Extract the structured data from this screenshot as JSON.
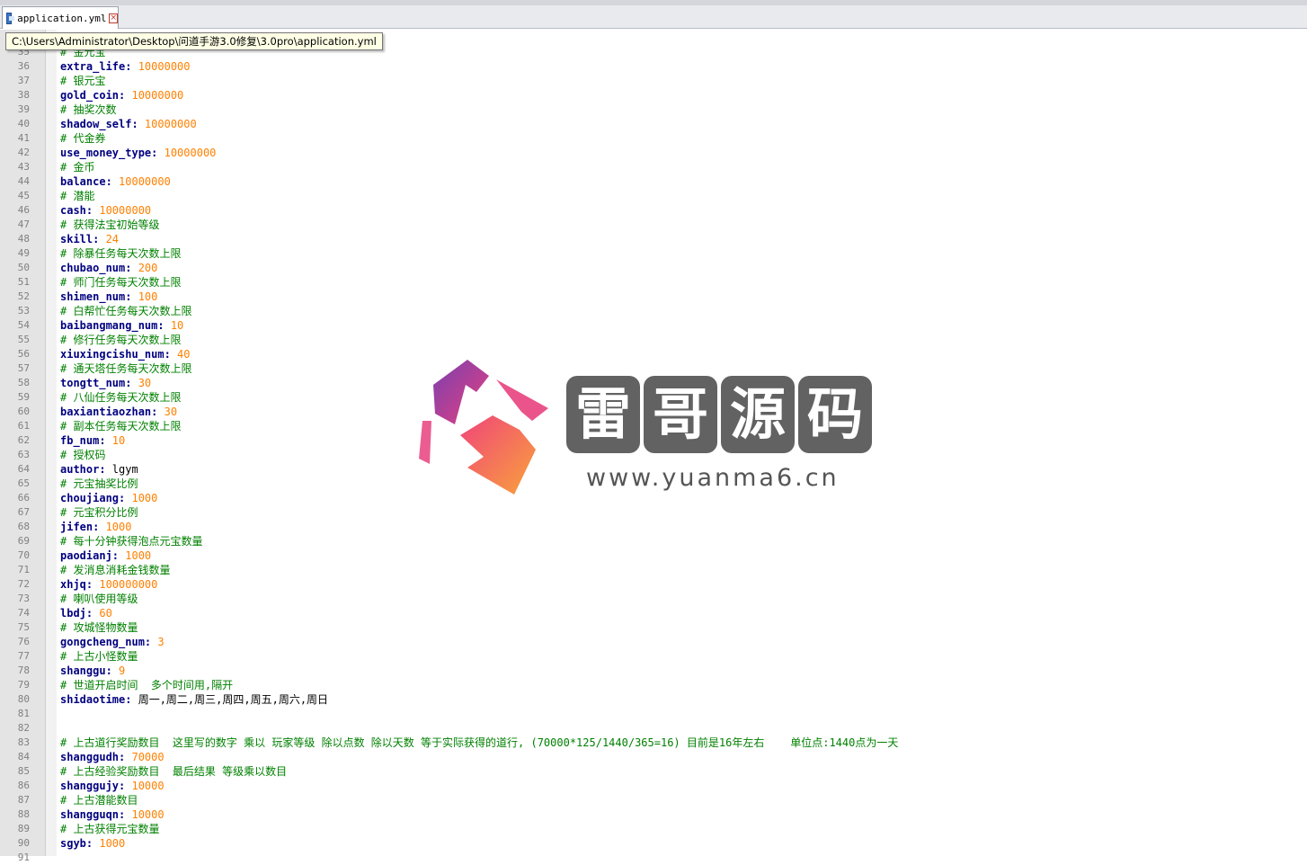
{
  "tab": {
    "filename": "application.yml",
    "close": "×"
  },
  "tooltip": {
    "path": "C:\\Users\\Administrator\\Desktop\\问道手游3.0修复\\3.0pro\\application.yml"
  },
  "editor": {
    "colors": {
      "key": "#000080",
      "number": "#ff8000",
      "comment": "#008000"
    },
    "lines": [
      {
        "n": "35",
        "k": "cmt",
        "c": "# 金元宝"
      },
      {
        "n": "36",
        "k": "kv",
        "key": "extra_life:",
        "v": "10000000",
        "t": "num"
      },
      {
        "n": "37",
        "k": "cmt",
        "c": "# 银元宝"
      },
      {
        "n": "38",
        "k": "kv",
        "key": "gold_coin:",
        "v": "10000000",
        "t": "num"
      },
      {
        "n": "39",
        "k": "cmt",
        "c": "# 抽奖次数"
      },
      {
        "n": "40",
        "k": "kv",
        "key": "shadow_self:",
        "v": "10000000",
        "t": "num"
      },
      {
        "n": "41",
        "k": "cmt",
        "c": "# 代金券"
      },
      {
        "n": "42",
        "k": "kv",
        "key": "use_money_type:",
        "v": "10000000",
        "t": "num"
      },
      {
        "n": "43",
        "k": "cmt",
        "c": "# 金币"
      },
      {
        "n": "44",
        "k": "kv",
        "key": "balance:",
        "v": "10000000",
        "t": "num"
      },
      {
        "n": "45",
        "k": "cmt",
        "c": "# 潜能"
      },
      {
        "n": "46",
        "k": "kv",
        "key": "cash:",
        "v": "10000000",
        "t": "num"
      },
      {
        "n": "47",
        "k": "cmt",
        "c": "# 获得法宝初始等级"
      },
      {
        "n": "48",
        "k": "kv",
        "key": "skill:",
        "v": "24",
        "t": "num"
      },
      {
        "n": "49",
        "k": "cmt",
        "c": "# 除暴任务每天次数上限"
      },
      {
        "n": "50",
        "k": "kv",
        "key": "chubao_num:",
        "v": "200",
        "t": "num"
      },
      {
        "n": "51",
        "k": "cmt",
        "c": "# 师门任务每天次数上限"
      },
      {
        "n": "52",
        "k": "kv",
        "key": "shimen_num:",
        "v": "100",
        "t": "num"
      },
      {
        "n": "53",
        "k": "cmt",
        "c": "# 白帮忙任务每天次数上限"
      },
      {
        "n": "54",
        "k": "kv",
        "key": "baibangmang_num:",
        "v": "10",
        "t": "num"
      },
      {
        "n": "55",
        "k": "cmt",
        "c": "# 修行任务每天次数上限"
      },
      {
        "n": "56",
        "k": "kv",
        "key": "xiuxingcishu_num:",
        "v": "40",
        "t": "num"
      },
      {
        "n": "57",
        "k": "cmt",
        "c": "# 通天塔任务每天次数上限"
      },
      {
        "n": "58",
        "k": "kv",
        "key": "tongtt_num:",
        "v": "30",
        "t": "num"
      },
      {
        "n": "59",
        "k": "cmt",
        "c": "# 八仙任务每天次数上限"
      },
      {
        "n": "60",
        "k": "kv",
        "key": "baxiantiaozhan:",
        "v": "30",
        "t": "num"
      },
      {
        "n": "61",
        "k": "cmt",
        "c": "# 副本任务每天次数上限"
      },
      {
        "n": "62",
        "k": "kv",
        "key": "fb_num:",
        "v": "10",
        "t": "num"
      },
      {
        "n": "63",
        "k": "cmt",
        "c": "# 授权码"
      },
      {
        "n": "64",
        "k": "kv",
        "key": "author:",
        "v": "lgym",
        "t": "str"
      },
      {
        "n": "65",
        "k": "cmt",
        "c": "# 元宝抽奖比例"
      },
      {
        "n": "66",
        "k": "kv",
        "key": "choujiang:",
        "v": "1000",
        "t": "num"
      },
      {
        "n": "67",
        "k": "cmt",
        "c": "# 元宝积分比例"
      },
      {
        "n": "68",
        "k": "kv",
        "key": "jifen:",
        "v": "1000",
        "t": "num"
      },
      {
        "n": "69",
        "k": "cmt",
        "c": "# 每十分钟获得泡点元宝数量"
      },
      {
        "n": "70",
        "k": "kv",
        "key": "paodianj:",
        "v": "1000",
        "t": "num"
      },
      {
        "n": "71",
        "k": "cmt",
        "c": "# 发消息消耗金钱数量"
      },
      {
        "n": "72",
        "k": "kv",
        "key": "xhjq:",
        "v": "100000000",
        "t": "num"
      },
      {
        "n": "73",
        "k": "cmt",
        "c": "# 喇叭使用等级"
      },
      {
        "n": "74",
        "k": "kv",
        "key": "lbdj:",
        "v": "60",
        "t": "num"
      },
      {
        "n": "75",
        "k": "cmt",
        "c": "# 攻城怪物数量"
      },
      {
        "n": "76",
        "k": "kv",
        "key": "gongcheng_num:",
        "v": "3",
        "t": "num"
      },
      {
        "n": "77",
        "k": "cmt",
        "c": "# 上古小怪数量"
      },
      {
        "n": "78",
        "k": "kv",
        "key": "shanggu:",
        "v": "9",
        "t": "num"
      },
      {
        "n": "79",
        "k": "cmt",
        "c": "# 世道开启时间  多个时间用,隔开"
      },
      {
        "n": "80",
        "k": "kv",
        "key": "shidaotime:",
        "v": "周一,周二,周三,周四,周五,周六,周日",
        "t": "str"
      },
      {
        "n": "81",
        "k": "empty",
        "c": ""
      },
      {
        "n": "82",
        "k": "empty",
        "c": ""
      },
      {
        "n": "83",
        "k": "cmt",
        "c": "# 上古道行奖励数目  这里写的数字 乘以 玩家等级 除以点数 除以天数 等于实际获得的道行, (70000*125/1440/365=16) 目前是16年左右    单位点:1440点为一天"
      },
      {
        "n": "84",
        "k": "kv",
        "key": "shanggudh:",
        "v": "70000",
        "t": "num"
      },
      {
        "n": "85",
        "k": "cmt",
        "c": "# 上古经验奖励数目  最后结果 等级乘以数目"
      },
      {
        "n": "86",
        "k": "kv",
        "key": "shanggujy:",
        "v": "10000",
        "t": "num"
      },
      {
        "n": "87",
        "k": "cmt",
        "c": "# 上古潜能数目"
      },
      {
        "n": "88",
        "k": "kv",
        "key": "shangguqn:",
        "v": "10000",
        "t": "num"
      },
      {
        "n": "89",
        "k": "cmt",
        "c": "# 上古获得元宝数量"
      },
      {
        "n": "90",
        "k": "kv",
        "key": "sgyb:",
        "v": "1000",
        "t": "num"
      },
      {
        "n": "91",
        "k": "empty",
        "c": ""
      }
    ]
  },
  "watermark": {
    "chars": [
      "雷",
      "哥",
      "源",
      "码"
    ],
    "url": "www.yuanma6.cn"
  }
}
